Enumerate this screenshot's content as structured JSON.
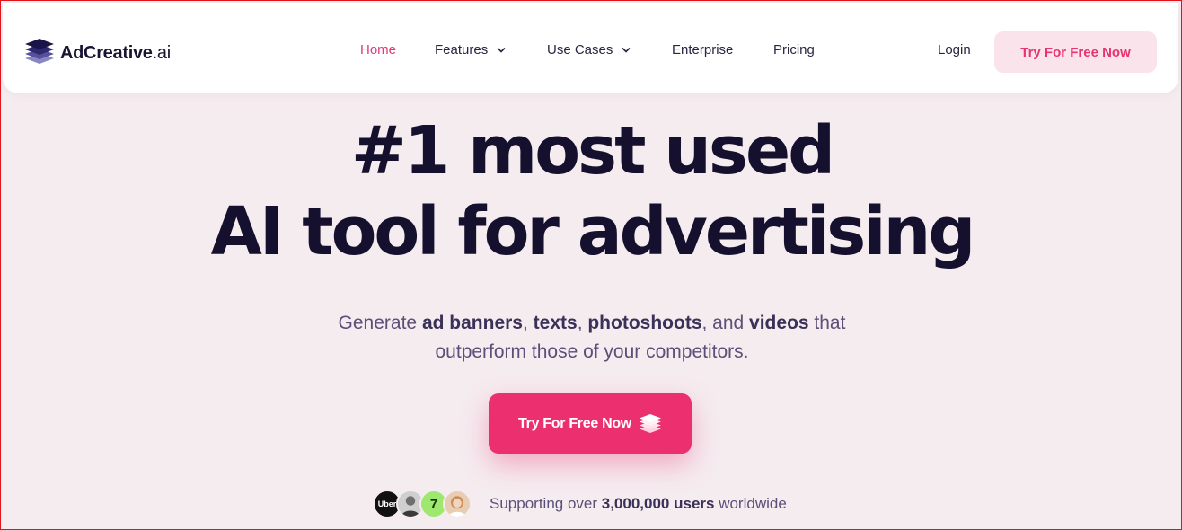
{
  "brand": {
    "name": "AdCreative",
    "suffix": ".ai",
    "icon": "stacked-layers-icon"
  },
  "nav": {
    "items": [
      {
        "label": "Home",
        "active": true,
        "dropdown": false
      },
      {
        "label": "Features",
        "active": false,
        "dropdown": true
      },
      {
        "label": "Use Cases",
        "active": false,
        "dropdown": true
      },
      {
        "label": "Enterprise",
        "active": false,
        "dropdown": false
      },
      {
        "label": "Pricing",
        "active": false,
        "dropdown": false
      }
    ],
    "login_label": "Login",
    "cta_label": "Try For Free Now"
  },
  "hero": {
    "title_line1": "#1 most used",
    "title_line2": "AI tool for advertising",
    "subtitle": {
      "prefix": "Generate ",
      "b1": "ad banners",
      "sep1": ", ",
      "b2": "texts",
      "sep2": ", ",
      "b3": "photoshoots",
      "sep3": ", and ",
      "b4": "videos",
      "suffix_line1": " that",
      "line2": "outperform those of your competitors."
    },
    "cta_label": "Try For Free Now"
  },
  "social_proof": {
    "avatars": [
      {
        "name": "uber-logo",
        "text": "Uber"
      },
      {
        "name": "user-avatar-man",
        "text": ""
      },
      {
        "name": "wise-logo",
        "text": "7"
      },
      {
        "name": "user-avatar-woman",
        "text": ""
      }
    ],
    "prefix": "Supporting over ",
    "count": "3,000,000 users",
    "suffix": " worldwide"
  },
  "colors": {
    "accent": "#ec2f6e",
    "accent_soft": "#fbe3ec",
    "background": "#f5ecf0",
    "heading": "#15102e"
  }
}
